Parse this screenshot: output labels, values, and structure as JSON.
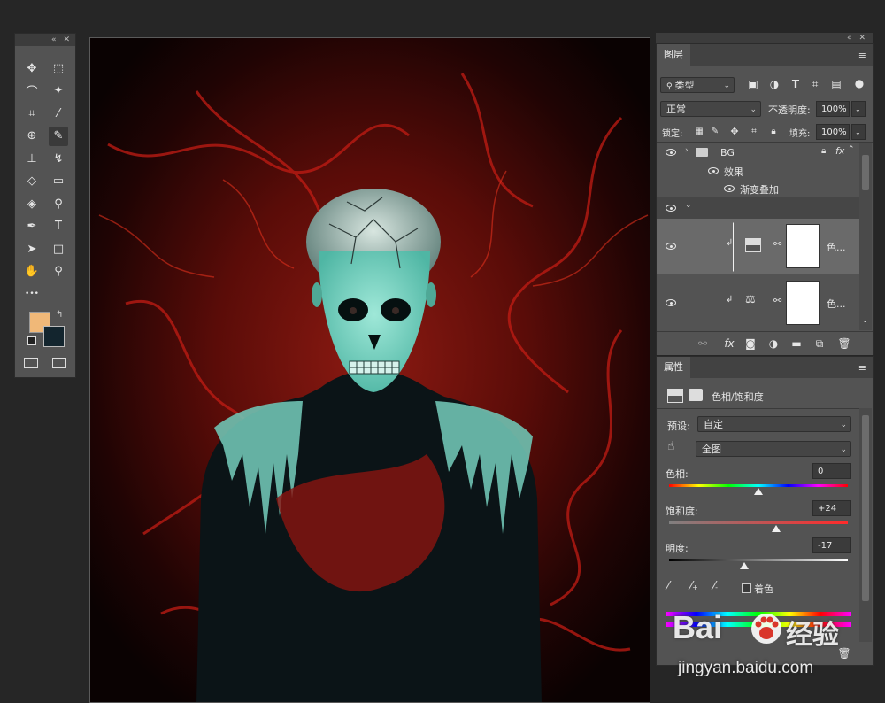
{
  "tools_panel": {
    "tools": [
      {
        "name": "move-tool",
        "glyph": "✥"
      },
      {
        "name": "marquee-tool",
        "glyph": "⬚"
      },
      {
        "name": "lasso-tool",
        "glyph": "⌒"
      },
      {
        "name": "magic-wand-tool",
        "glyph": "✦"
      },
      {
        "name": "crop-tool",
        "glyph": "⌗"
      },
      {
        "name": "eyedropper-tool",
        "glyph": "⁄"
      },
      {
        "name": "healing-brush-tool",
        "glyph": "⊕"
      },
      {
        "name": "brush-tool",
        "glyph": "✎"
      },
      {
        "name": "clone-stamp-tool",
        "glyph": "⊥"
      },
      {
        "name": "history-brush-tool",
        "glyph": "↯"
      },
      {
        "name": "eraser-tool",
        "glyph": "◇"
      },
      {
        "name": "gradient-tool",
        "glyph": "▭"
      },
      {
        "name": "blur-tool",
        "glyph": "◈"
      },
      {
        "name": "dodge-tool",
        "glyph": "⚲"
      },
      {
        "name": "pen-tool",
        "glyph": "✒"
      },
      {
        "name": "type-tool",
        "glyph": "T"
      },
      {
        "name": "path-selection-tool",
        "glyph": "➤"
      },
      {
        "name": "rectangle-tool",
        "glyph": "□"
      },
      {
        "name": "hand-tool",
        "glyph": "✋"
      },
      {
        "name": "zoom-tool",
        "glyph": "⚲"
      },
      {
        "name": "more-tools",
        "glyph": "•••"
      }
    ],
    "foreground_color": "#f0b878",
    "background_color": "#13252e"
  },
  "layers_panel": {
    "tab_label": "图层",
    "filter_label": "类型",
    "blend_mode": "正常",
    "opacity_label": "不透明度:",
    "opacity_value": "100%",
    "lock_label": "锁定:",
    "fill_label": "填充:",
    "fill_value": "100%",
    "group_name": "BG",
    "effects_label": "效果",
    "effect_item": "渐变叠加",
    "layer1_name": "色...",
    "layer2_name": "色..."
  },
  "properties_panel": {
    "tab_label": "属性",
    "title": "色相/饱和度",
    "preset_label": "预设:",
    "preset_value": "自定",
    "channel_value": "全图",
    "hue_label": "色相:",
    "hue_value": "0",
    "saturation_label": "饱和度:",
    "saturation_value": "+24",
    "lightness_label": "明度:",
    "lightness_value": "-17",
    "colorize_label": "着色",
    "hue_position": 0.5,
    "saturation_position": 0.6,
    "lightness_position": 0.42
  },
  "watermark": {
    "brand": "Bai",
    "brand2": "经验",
    "url": "jingyan.baidu.com"
  }
}
